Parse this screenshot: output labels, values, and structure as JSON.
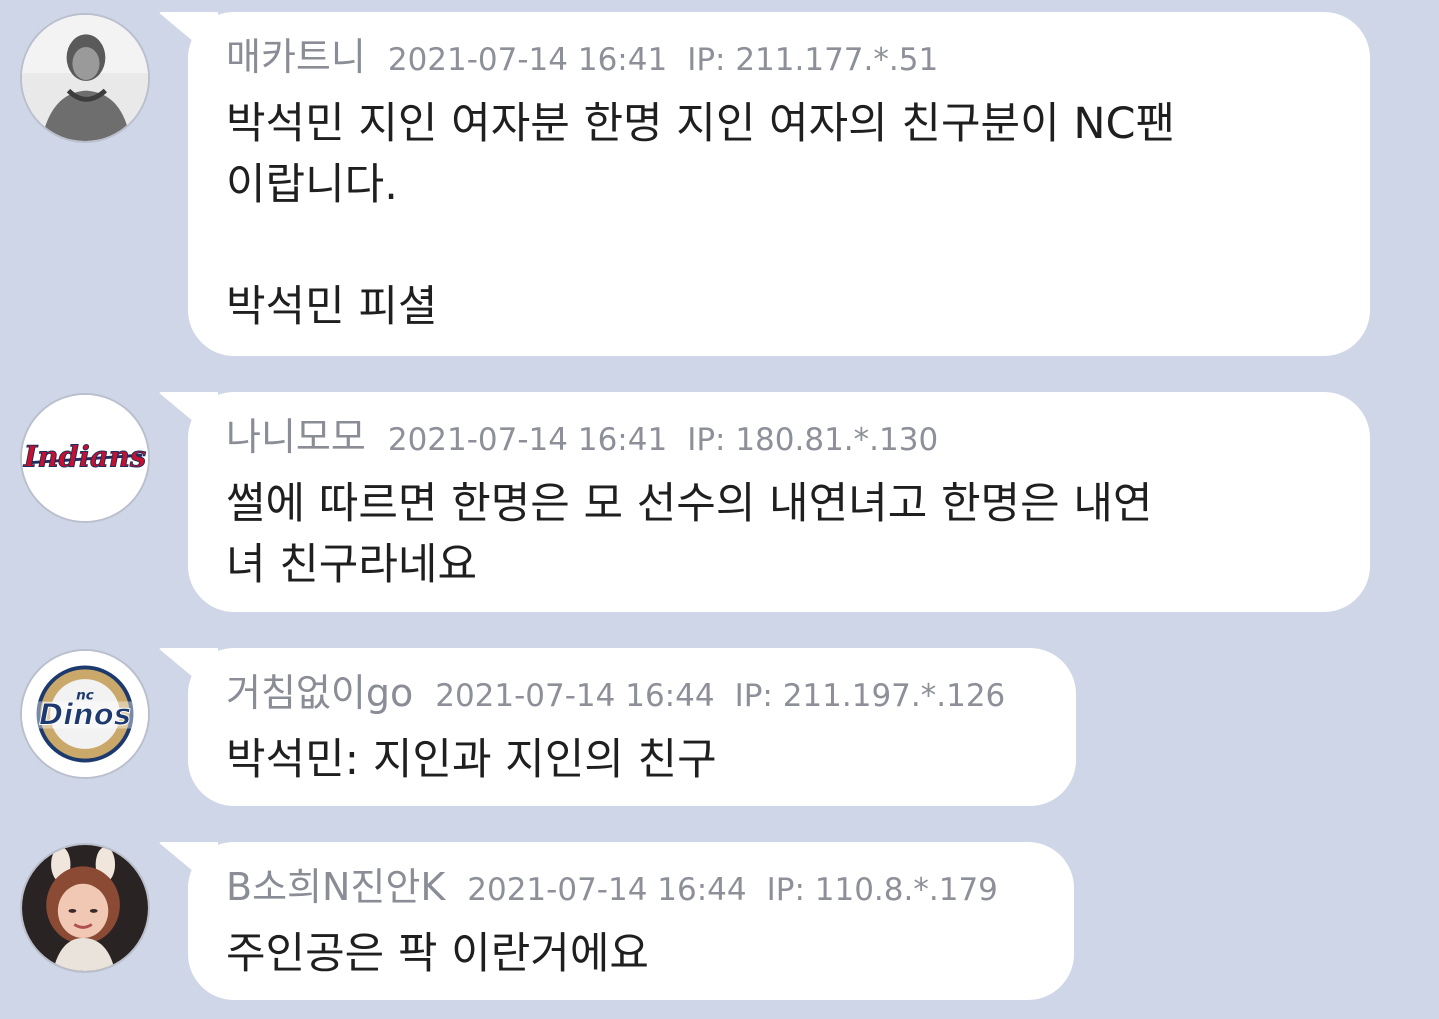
{
  "comments": [
    {
      "nickname": "매카트니",
      "date": "2021-07-14 16:41",
      "ip": "IP: 211.177.*.51",
      "text": "박석민 지인 여자분 한명 지인 여자의 친구분이 NC팬\n이랍니다.\n\n박석민 피셜",
      "avatar": "person-bw-photo"
    },
    {
      "nickname": "나니모모",
      "date": "2021-07-14 16:41",
      "ip": "IP: 180.81.*.130",
      "text": "썰에 따르면 한명은 모 선수의 내연녀고 한명은 내연\n녀 친구라네요",
      "avatar": "indians-logo",
      "avatar_logo_text": "Indians"
    },
    {
      "nickname": "거침없이go",
      "date": "2021-07-14 16:44",
      "ip": "IP: 211.197.*.126",
      "text": "박석민: 지인과 지인의 친구",
      "avatar": "nc-dinos-logo",
      "avatar_logo_text": "Dinos",
      "avatar_logo_small": "nc"
    },
    {
      "nickname": "B소희N진안K",
      "date": "2021-07-14 16:44",
      "ip": "IP: 110.8.*.179",
      "text": "주인공은 팍 이란거에요",
      "avatar": "person-photo"
    }
  ],
  "colors": {
    "background": "#cfd6e7",
    "bubble": "#ffffff",
    "meta_text": "#8d9099",
    "body_text": "#1f1f1f",
    "indians_red": "#c8102e",
    "dinos_navy": "#1d3a6e"
  }
}
